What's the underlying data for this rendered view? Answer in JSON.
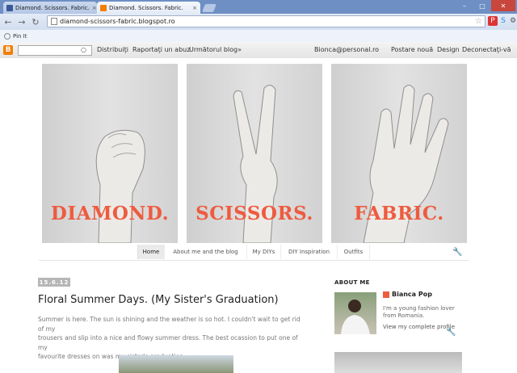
{
  "browser": {
    "tabs": [
      {
        "title": "Diamond. Scissors. Fabric.",
        "favicon_color": "#3b5998"
      },
      {
        "title": "Diamond. Scissors. Fabric.",
        "favicon_color": "#f57d00"
      }
    ],
    "close_glyph": "×",
    "address": "diamond-scissors-fabric.blogspot.ro",
    "bookmark": "Pin It"
  },
  "navbar": {
    "logo": "B",
    "links": [
      "Distribuiţi",
      "Raportaţi un abuz",
      "Următorul blog»"
    ],
    "email": "Bionca@personal.ro",
    "right_links": [
      "Postare nouă",
      "Design",
      "Deconectaţi-vă"
    ]
  },
  "header": {
    "panels": [
      "DIAMOND.",
      "SCISSORS.",
      "FABRIC."
    ],
    "accent_color": "#ee5b3f"
  },
  "page_tabs": [
    "Home",
    "About me and the blog",
    "My DIYs",
    "DIY Inspiration",
    "Outfits"
  ],
  "post": {
    "date": "15.6.12",
    "title": "Floral Summer Days. (My Sister's Graduation)",
    "body_lines": [
      "Summer is here. The sun is shining and the weather is so hot. I couldn't wait to get rid of my",
      "trousers and slip into a nice and flowy summer dress. The best ocassion to put one of my",
      "favourite dresses on was my sister's graduation."
    ]
  },
  "sidebar": {
    "about_heading": "ABOUT ME",
    "name": "Bianca Pop",
    "description": "I'm a young fashion lover from Romania.",
    "profile_link": "View my complete profile"
  }
}
